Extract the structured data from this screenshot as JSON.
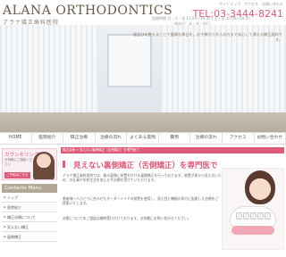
{
  "header": {
    "logo": "ALANA ORTHODONTICS",
    "logo_sub": "アラナ矯正歯科医院",
    "top_links": "サイトマップ　アクセス　お問い合わせ",
    "tel": "TEL:03-3444-8241",
    "hours": "診療時間 月・火・金 11:00〜19:30 / 土・日 10:00〜18:30",
    "hours2": "休診日：水・木・祝日"
  },
  "hero": {
    "copy1": "歯並びを整えることで健康な毎日を。お子様から大人の方まで安心して通える矯正歯科です。"
  },
  "nav": [
    {
      "label": "HOME",
      "name": "nav-home"
    },
    {
      "label": "医院紹介",
      "name": "nav-clinic"
    },
    {
      "label": "矯正治療",
      "name": "nav-treatment"
    },
    {
      "label": "治療の流れ",
      "name": "nav-flow"
    },
    {
      "label": "よくある質問",
      "name": "nav-faq"
    },
    {
      "label": "費用",
      "name": "nav-fee"
    },
    {
      "label": "治療の流れ",
      "name": "nav-flow2"
    },
    {
      "label": "アクセス",
      "name": "nav-access"
    },
    {
      "label": "お問い合わせ",
      "name": "nav-contact"
    }
  ],
  "sidebar": {
    "counsel_title": "カウンセリング予約",
    "counsel_sub": "お気軽にご相談ください",
    "counsel_btn": "ご予約はこちら",
    "menu_head": "Contents Menu",
    "items": [
      "トップ",
      "医院紹介",
      "矯正治療について",
      "見えない矯正",
      "裏側矯正"
    ]
  },
  "main": {
    "breadcrumb": "矯正治療 > 見えない裏側矯正（舌側矯正）を専門医で",
    "title": "見えない裏側矯正（舌側矯正）を専門医で",
    "para1": "アラナ矯正歯科医院では、歯の裏側に装置を付ける裏側矯正を行っております。装置が表から見えないため、お仕事や学校生活を気にせず治療を受けていただけます。",
    "para2": "患者様一人ひとりに合わせたオーダーメイドの装置を使用し、見た目と機能の両方に配慮した治療をご提案いたします。",
    "para3": "治療についてのご相談は随時受け付けております。お気軽にお問い合わせください。"
  }
}
